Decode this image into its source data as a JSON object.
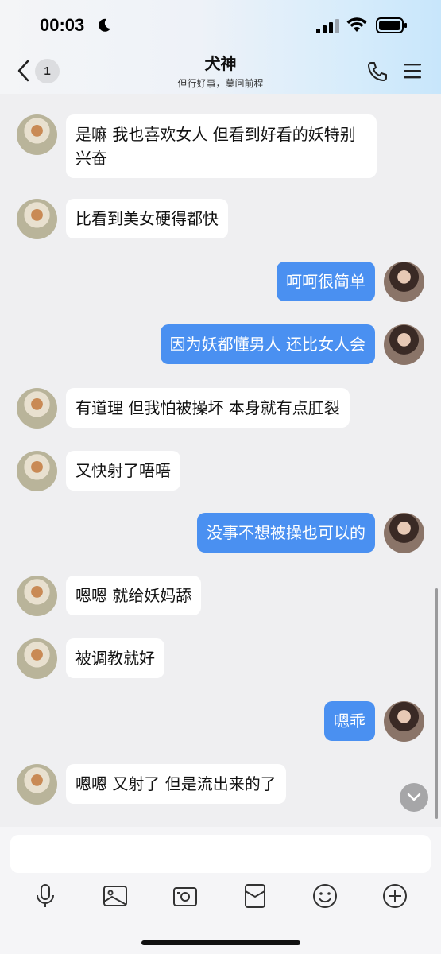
{
  "status_bar": {
    "time": "00:03"
  },
  "header": {
    "unread_count": "1",
    "title": "犬神",
    "subtitle": "但行好事，莫问前程"
  },
  "messages": [
    {
      "side": "in",
      "text": "是嘛 我也喜欢女人 但看到好看的妖特别兴奋"
    },
    {
      "side": "in",
      "text": "比看到美女硬得都快"
    },
    {
      "side": "out",
      "text": "呵呵很简单"
    },
    {
      "side": "out",
      "text": "因为妖都懂男人 还比女人会"
    },
    {
      "side": "in",
      "text": "有道理 但我怕被操坏 本身就有点肛裂"
    },
    {
      "side": "in",
      "text": "又快射了唔唔"
    },
    {
      "side": "out",
      "text": "没事不想被操也可以的"
    },
    {
      "side": "in",
      "text": "嗯嗯 就给妖妈舔"
    },
    {
      "side": "in",
      "text": "被调教就好"
    },
    {
      "side": "out",
      "text": "嗯乖"
    },
    {
      "side": "in",
      "text": "嗯嗯 又射了 但是流出来的了"
    }
  ],
  "composer": {
    "input_value": "",
    "tools": [
      "microphone-icon",
      "image-icon",
      "camera-icon",
      "red-packet-icon",
      "emoji-icon",
      "plus-icon"
    ]
  },
  "colors": {
    "outgoing_bubble": "#4a90f1",
    "incoming_bubble": "#ffffff",
    "background": "#efeff1"
  }
}
